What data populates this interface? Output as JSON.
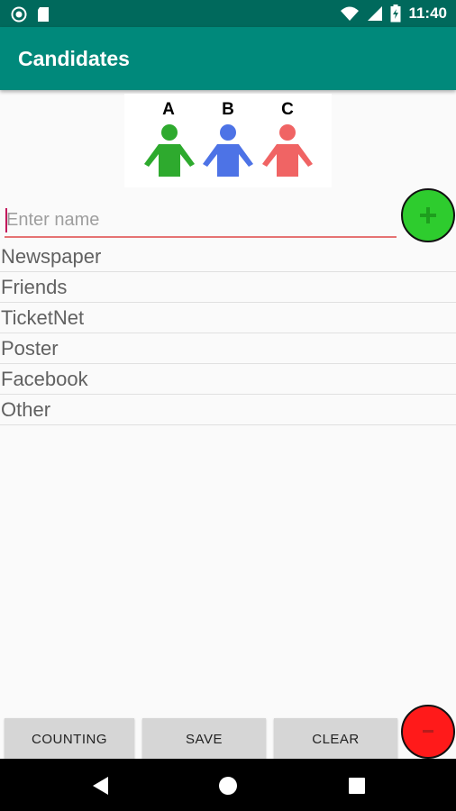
{
  "status_bar": {
    "time": "11:40",
    "left_icons": [
      "record-icon",
      "sd-card-icon"
    ],
    "right_icons": [
      "wifi-icon",
      "signal-icon",
      "battery-charging-icon"
    ]
  },
  "app_bar": {
    "title": "Candidates",
    "color": "#00897b"
  },
  "hero": {
    "people": [
      {
        "label": "A",
        "color": "#2eaa2e"
      },
      {
        "label": "B",
        "color": "#4d73e6"
      },
      {
        "label": "C",
        "color": "#f06464"
      }
    ]
  },
  "name_input": {
    "placeholder": "Enter name",
    "value": ""
  },
  "add_button": {
    "glyph": "+",
    "color": "#2ecc2e"
  },
  "remove_button": {
    "glyph": "-",
    "color": "#ff1a1a"
  },
  "list": {
    "items": [
      "Newspaper",
      "Friends",
      "TicketNet",
      "Poster",
      "Facebook",
      "Other"
    ]
  },
  "buttons": {
    "counting": "COUNTING",
    "save": "SAVE",
    "clear": "CLEAR"
  },
  "nav_bar": {
    "icons": [
      "back-icon",
      "home-icon",
      "recents-icon"
    ]
  }
}
